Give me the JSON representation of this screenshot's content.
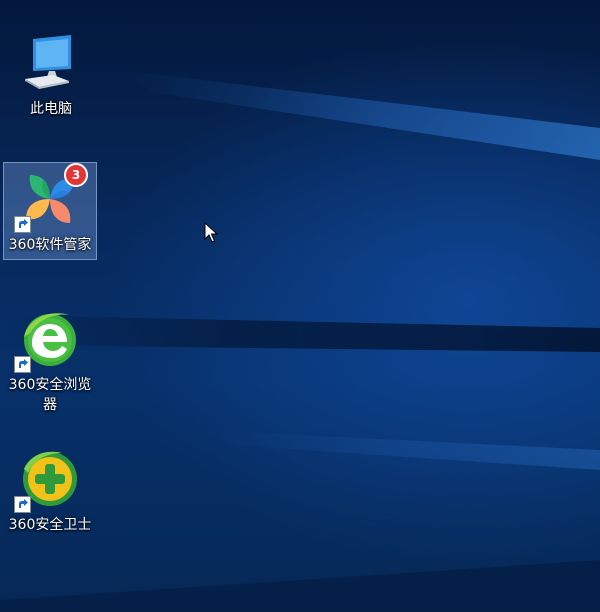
{
  "desktop": {
    "icons": [
      {
        "id": "this-pc",
        "label": "此电脑",
        "icon": "computer-icon",
        "selected": false
      },
      {
        "id": "360-software-manager",
        "label": "360软件管家",
        "icon": "360-software-manager-icon",
        "badge": "3",
        "selected": true
      },
      {
        "id": "360-secure-browser",
        "label": "360安全浏览器",
        "icon": "360-browser-icon",
        "selected": false
      },
      {
        "id": "360-total-security",
        "label": "360安全卫士",
        "icon": "360-security-icon",
        "selected": false
      }
    ]
  },
  "colors": {
    "wallpaper_dark": "#03183c",
    "wallpaper_mid": "#07306a",
    "selection": "#7aa0dc",
    "badge": "#e33535",
    "browser_green": "#3cae3c",
    "security_yellow": "#f1c21a",
    "security_green": "#2f9a39"
  }
}
